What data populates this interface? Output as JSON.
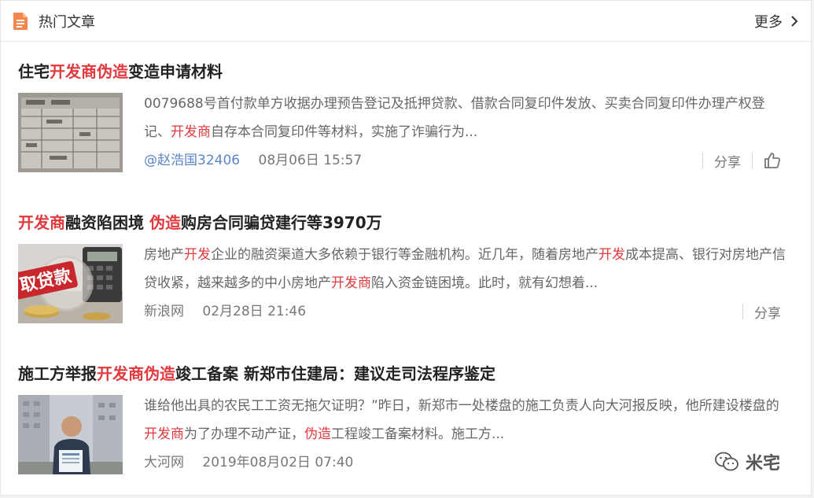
{
  "header": {
    "title": "热门文章",
    "more_label": "更多",
    "doc_icon": "document-icon",
    "accent": "#f2874f"
  },
  "articles": [
    {
      "title_parts": [
        {
          "text": "住宅",
          "hl": false
        },
        {
          "text": "开发商伪造",
          "hl": true
        },
        {
          "text": "变造申请材料",
          "hl": false
        }
      ],
      "summary_parts": [
        {
          "text": "0079688号首付款单方收据办理预告登记及抵押贷款、借款合同复印件发放、买卖合同复印件办理产权登记、",
          "hl": false
        },
        {
          "text": "开发商",
          "hl": true
        },
        {
          "text": "自存本合同复印件等材料，实施了诈骗行为...",
          "hl": false
        }
      ],
      "author": "@赵浩国32406",
      "time": "08月06日 15:57",
      "share_label": "分享",
      "has_like": true
    },
    {
      "title_parts": [
        {
          "text": "开发商",
          "hl": true
        },
        {
          "text": "融资陷困境 ",
          "hl": false
        },
        {
          "text": "伪造",
          "hl": true
        },
        {
          "text": "购房合同骗贷建行等3970万",
          "hl": false
        }
      ],
      "summary_parts": [
        {
          "text": "房地产",
          "hl": false
        },
        {
          "text": "开发",
          "hl": true
        },
        {
          "text": "企业的融资渠道大多依赖于银行等金融机构。近几年，随着房地产",
          "hl": false
        },
        {
          "text": "开发",
          "hl": true
        },
        {
          "text": "成本提高、银行对房地产信贷收紧，越来越多的中小房地产",
          "hl": false
        },
        {
          "text": "开发商",
          "hl": true
        },
        {
          "text": "陷入资金链困境。此时，就有幻想着...",
          "hl": false
        }
      ],
      "source": "新浪网",
      "time": "02月28日 21:46",
      "share_label": "分享",
      "has_like": false,
      "thumb_text": "取贷款"
    },
    {
      "title_parts": [
        {
          "text": "施工方举报",
          "hl": false
        },
        {
          "text": "开发商伪造",
          "hl": true
        },
        {
          "text": "竣工备案 新郑市住建局：建议走司法程序鉴定",
          "hl": false
        }
      ],
      "summary_parts": [
        {
          "text": "谁给他出具的农民工工资无拖欠证明？”昨日，新郑市一处楼盘的施工负责人向大河报反映，他所建设楼盘的",
          "hl": false
        },
        {
          "text": "开发商",
          "hl": true
        },
        {
          "text": "为了办理不动产证，",
          "hl": false
        },
        {
          "text": "伪造",
          "hl": true
        },
        {
          "text": "工程竣工备案材料。施工方...",
          "hl": false
        }
      ],
      "source": "大河网",
      "time": "2019年08月02日 07:40",
      "has_like": false
    }
  ],
  "watermark": "米宅",
  "colors": {
    "highlight": "#e03a3e",
    "author": "#5a86c7",
    "text": "#666666"
  }
}
